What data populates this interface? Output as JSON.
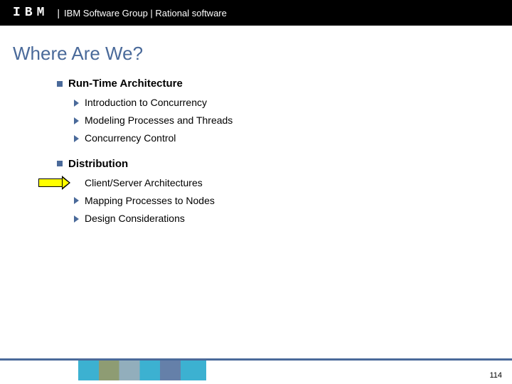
{
  "header": {
    "logo": "IBM",
    "title": "IBM Software Group | Rational software"
  },
  "slide": {
    "title": "Where Are We?"
  },
  "sections": [
    {
      "title": "Run-Time Architecture",
      "items": [
        {
          "text": "Introduction to Concurrency",
          "current": false
        },
        {
          "text": "Modeling Processes and Threads",
          "current": false
        },
        {
          "text": "Concurrency Control",
          "current": false
        }
      ]
    },
    {
      "title": "Distribution",
      "items": [
        {
          "text": "Client/Server Architectures",
          "current": true
        },
        {
          "text": "Mapping Processes to Nodes",
          "current": false
        },
        {
          "text": "Design Considerations",
          "current": false
        }
      ]
    }
  ],
  "footer": {
    "page": "114"
  }
}
